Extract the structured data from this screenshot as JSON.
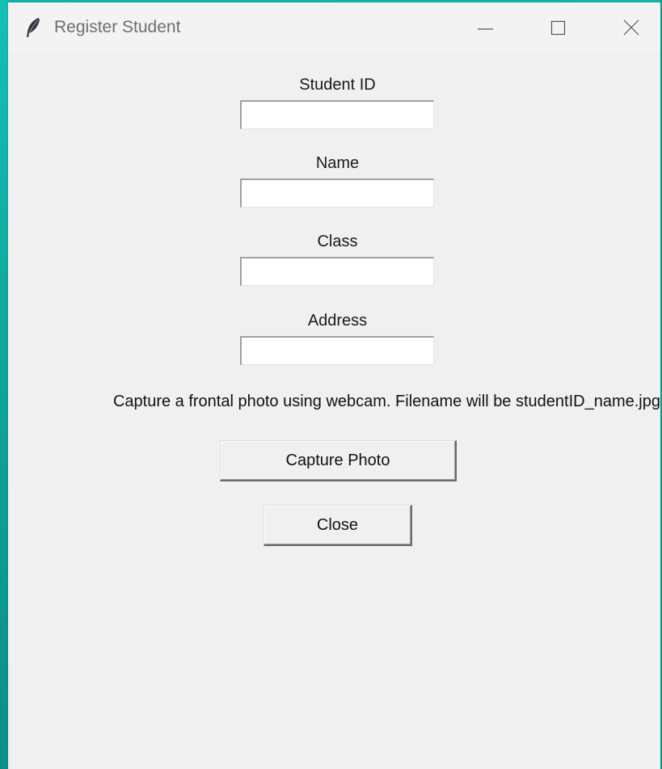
{
  "window": {
    "title": "Register Student",
    "icon": "feather-icon",
    "controls": [
      "minimize-icon",
      "maximize-icon",
      "close-icon"
    ]
  },
  "form": {
    "fields": [
      {
        "label": "Student ID",
        "value": "",
        "placeholder": ""
      },
      {
        "label": "Name",
        "value": "",
        "placeholder": ""
      },
      {
        "label": "Class",
        "value": "",
        "placeholder": ""
      },
      {
        "label": "Address",
        "value": "",
        "placeholder": ""
      }
    ],
    "instructions": "Capture a frontal photo using webcam. Filename will be studentID_name.jpg",
    "capture_button": "Capture Photo",
    "close_button": "Close"
  },
  "colors": {
    "window_bg": "#f0f0f0",
    "desktop_accent": "#11b9b0"
  }
}
